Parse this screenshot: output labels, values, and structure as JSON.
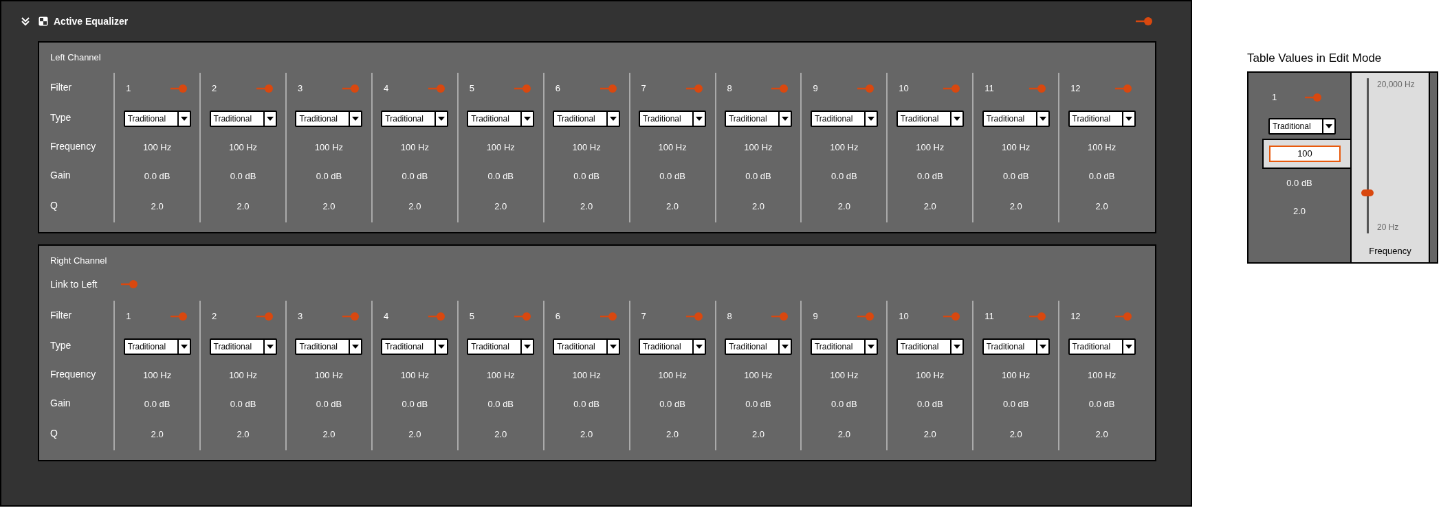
{
  "header": {
    "title": "Active Equalizer",
    "on": true
  },
  "channels": [
    {
      "title": "Left Channel",
      "row_labels": [
        "Filter",
        "Type",
        "Frequency",
        "Gain",
        "Q"
      ],
      "filters": [
        {
          "number": "1",
          "on": true,
          "type": "Traditional",
          "frequency": "100 Hz",
          "gain": "0.0 dB",
          "q": "2.0"
        },
        {
          "number": "2",
          "on": true,
          "type": "Traditional",
          "frequency": "100 Hz",
          "gain": "0.0 dB",
          "q": "2.0"
        },
        {
          "number": "3",
          "on": true,
          "type": "Traditional",
          "frequency": "100 Hz",
          "gain": "0.0 dB",
          "q": "2.0"
        },
        {
          "number": "4",
          "on": true,
          "type": "Traditional",
          "frequency": "100 Hz",
          "gain": "0.0 dB",
          "q": "2.0"
        },
        {
          "number": "5",
          "on": true,
          "type": "Traditional",
          "frequency": "100 Hz",
          "gain": "0.0 dB",
          "q": "2.0"
        },
        {
          "number": "6",
          "on": true,
          "type": "Traditional",
          "frequency": "100 Hz",
          "gain": "0.0 dB",
          "q": "2.0"
        },
        {
          "number": "7",
          "on": true,
          "type": "Traditional",
          "frequency": "100 Hz",
          "gain": "0.0 dB",
          "q": "2.0"
        },
        {
          "number": "8",
          "on": true,
          "type": "Traditional",
          "frequency": "100 Hz",
          "gain": "0.0 dB",
          "q": "2.0"
        },
        {
          "number": "9",
          "on": true,
          "type": "Traditional",
          "frequency": "100 Hz",
          "gain": "0.0 dB",
          "q": "2.0"
        },
        {
          "number": "10",
          "on": true,
          "type": "Traditional",
          "frequency": "100 Hz",
          "gain": "0.0 dB",
          "q": "2.0"
        },
        {
          "number": "11",
          "on": true,
          "type": "Traditional",
          "frequency": "100 Hz",
          "gain": "0.0 dB",
          "q": "2.0"
        },
        {
          "number": "12",
          "on": true,
          "type": "Traditional",
          "frequency": "100 Hz",
          "gain": "0.0 dB",
          "q": "2.0"
        }
      ]
    },
    {
      "title": "Right Channel",
      "link": {
        "label": "Link to Left",
        "on": true
      },
      "row_labels": [
        "Filter",
        "Type",
        "Frequency",
        "Gain",
        "Q"
      ],
      "filters": [
        {
          "number": "1",
          "on": true,
          "type": "Traditional",
          "frequency": "100 Hz",
          "gain": "0.0 dB",
          "q": "2.0"
        },
        {
          "number": "2",
          "on": true,
          "type": "Traditional",
          "frequency": "100 Hz",
          "gain": "0.0 dB",
          "q": "2.0"
        },
        {
          "number": "3",
          "on": true,
          "type": "Traditional",
          "frequency": "100 Hz",
          "gain": "0.0 dB",
          "q": "2.0"
        },
        {
          "number": "4",
          "on": true,
          "type": "Traditional",
          "frequency": "100 Hz",
          "gain": "0.0 dB",
          "q": "2.0"
        },
        {
          "number": "5",
          "on": true,
          "type": "Traditional",
          "frequency": "100 Hz",
          "gain": "0.0 dB",
          "q": "2.0"
        },
        {
          "number": "6",
          "on": true,
          "type": "Traditional",
          "frequency": "100 Hz",
          "gain": "0.0 dB",
          "q": "2.0"
        },
        {
          "number": "7",
          "on": true,
          "type": "Traditional",
          "frequency": "100 Hz",
          "gain": "0.0 dB",
          "q": "2.0"
        },
        {
          "number": "8",
          "on": true,
          "type": "Traditional",
          "frequency": "100 Hz",
          "gain": "0.0 dB",
          "q": "2.0"
        },
        {
          "number": "9",
          "on": true,
          "type": "Traditional",
          "frequency": "100 Hz",
          "gain": "0.0 dB",
          "q": "2.0"
        },
        {
          "number": "10",
          "on": true,
          "type": "Traditional",
          "frequency": "100 Hz",
          "gain": "0.0 dB",
          "q": "2.0"
        },
        {
          "number": "11",
          "on": true,
          "type": "Traditional",
          "frequency": "100 Hz",
          "gain": "0.0 dB",
          "q": "2.0"
        },
        {
          "number": "12",
          "on": true,
          "type": "Traditional",
          "frequency": "100 Hz",
          "gain": "0.0 dB",
          "q": "2.0"
        }
      ]
    }
  ],
  "edit_mode": {
    "title": "Table Values in Edit Mode",
    "filter": {
      "number": "1",
      "on": true,
      "type": "Traditional",
      "frequency_value": "100",
      "gain": "0.0 dB",
      "q": "2.0"
    },
    "slider": {
      "max_label": "20,000 Hz",
      "min_label": "20 Hz",
      "level": 0.26,
      "label": "Frequency"
    }
  }
}
